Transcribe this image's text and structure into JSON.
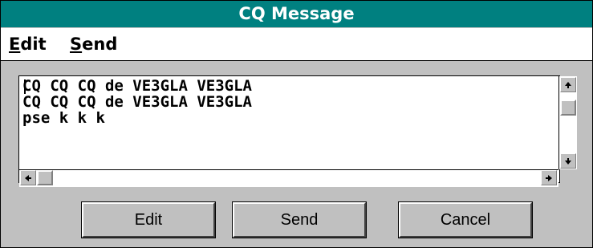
{
  "window": {
    "title": "CQ Message"
  },
  "menu": {
    "items": [
      {
        "mnemonic": "E",
        "rest": "dit"
      },
      {
        "mnemonic": "S",
        "rest": "end"
      }
    ]
  },
  "editor": {
    "lines": [
      "CQ CQ CQ de VE3GLA VE3GLA",
      "CQ CQ CQ de VE3GLA VE3GLA",
      "pse k k k"
    ]
  },
  "buttons": {
    "edit": "Edit",
    "send": "Send",
    "cancel": "Cancel"
  },
  "icons": {
    "scroll_up": "arrow-up-icon",
    "scroll_down": "arrow-down-icon",
    "scroll_left": "arrow-left-icon",
    "scroll_right": "arrow-right-icon"
  },
  "colors": {
    "title_bar": "#008080",
    "dialog_bg": "#c0c0c0"
  }
}
